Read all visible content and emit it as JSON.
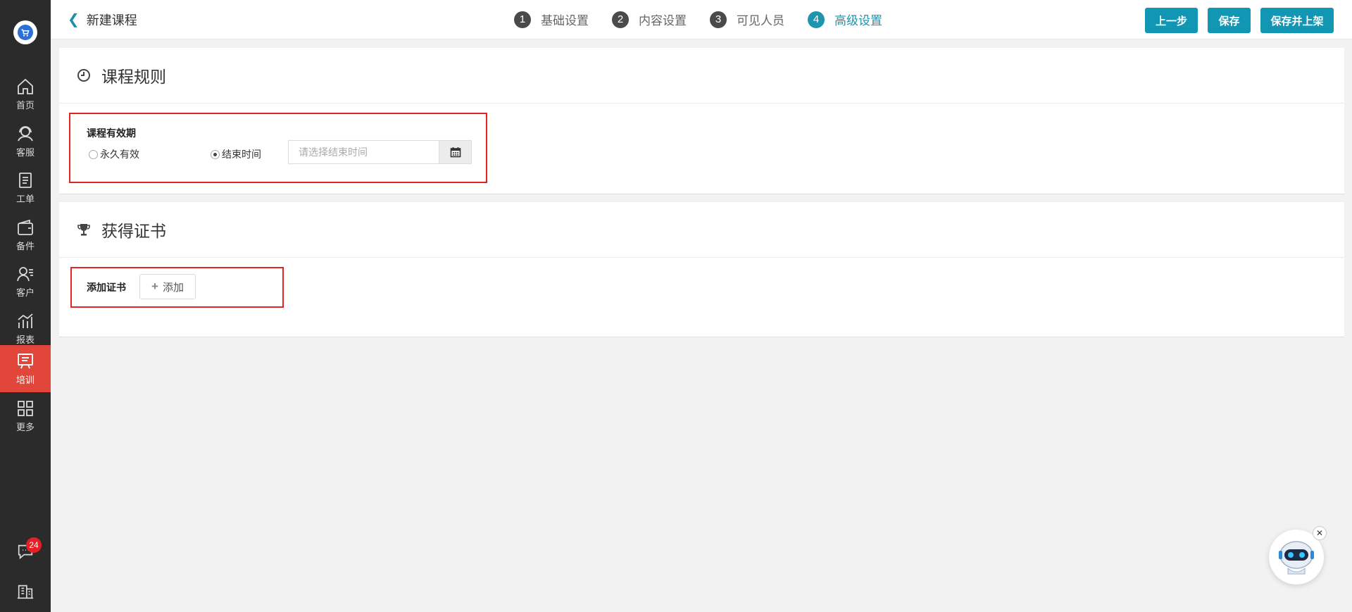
{
  "sidebar": {
    "items": [
      {
        "label": "首页",
        "icon": "home-icon"
      },
      {
        "label": "客服",
        "icon": "headset-icon"
      },
      {
        "label": "工单",
        "icon": "clipboard-icon"
      },
      {
        "label": "备件",
        "icon": "wallet-icon"
      },
      {
        "label": "客户",
        "icon": "customer-icon"
      },
      {
        "label": "报表",
        "icon": "chart-icon"
      },
      {
        "label": "培训",
        "icon": "training-icon",
        "active": true
      },
      {
        "label": "更多",
        "icon": "grid-icon"
      }
    ],
    "message_badge": "24",
    "active_color": "#e2453a"
  },
  "header": {
    "back_label": "新建课程",
    "steps": [
      {
        "num": "1",
        "label": "基础设置"
      },
      {
        "num": "2",
        "label": "内容设置"
      },
      {
        "num": "3",
        "label": "可见人员"
      },
      {
        "num": "4",
        "label": "高级设置",
        "current": true
      }
    ],
    "buttons": {
      "prev": "上一步",
      "save": "保存",
      "save_publish": "保存并上架"
    },
    "accent_color": "#1196b3"
  },
  "rules": {
    "title": "课程规则",
    "validity_label": "课程有效期",
    "option_forever": "永久有效",
    "option_end_time": "结束时间",
    "selected_option": "结束时间",
    "date_placeholder": "请选择结束时间"
  },
  "certificate": {
    "title": "获得证书",
    "add_label": "添加证书",
    "add_button": "添加"
  }
}
